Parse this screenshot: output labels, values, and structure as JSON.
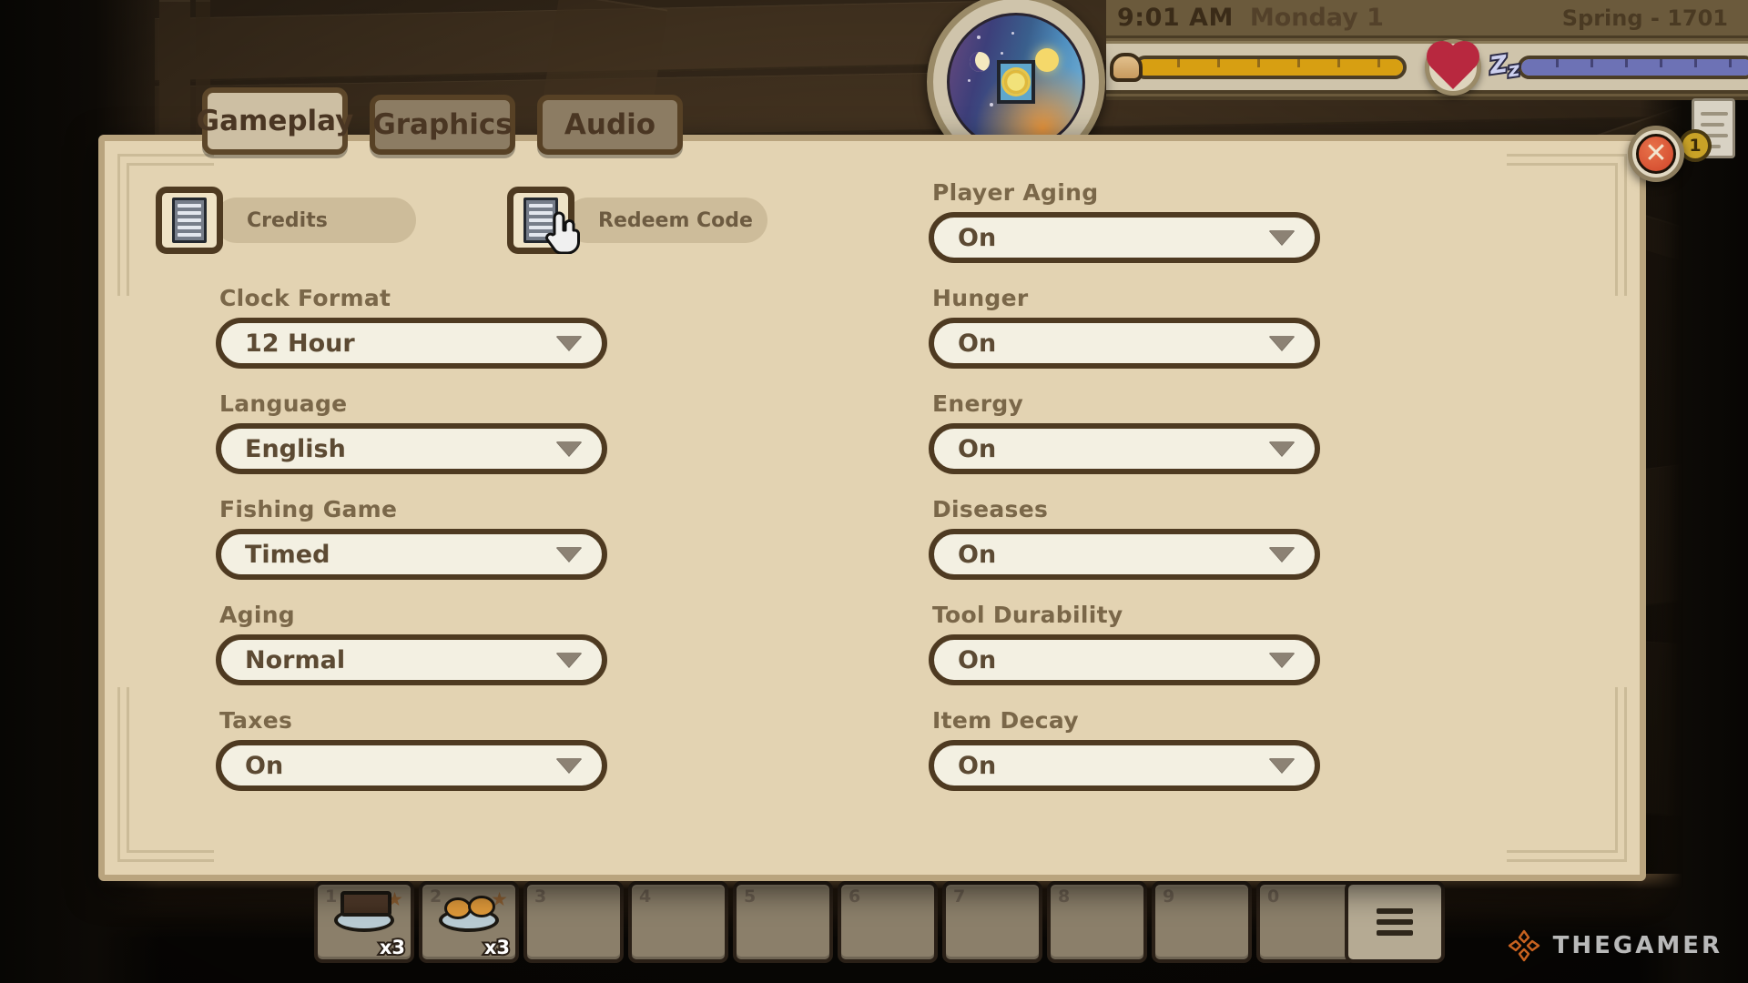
{
  "hud": {
    "time": "9:01 AM",
    "day": "Monday 1",
    "season": "Spring - 1701",
    "daynight_icon": "sun-dial-icon",
    "moon_icon": "moon-icon",
    "sun_icon": "sun-icon",
    "hunger_icon": "bread-icon",
    "hunger_percent": 100,
    "health_icon": "heart-icon",
    "energy_icon": "zzz-sleep-icon",
    "energy_percent": 100,
    "quest_icon": "scroll-icon",
    "quest_count": "1",
    "colors": {
      "hunger_fill": "#d79f12",
      "energy_fill": "#6d72b5",
      "heart": "#b8283f"
    }
  },
  "tabs": [
    {
      "label": "Gameplay",
      "active": true
    },
    {
      "label": "Graphics",
      "active": false
    },
    {
      "label": "Audio",
      "active": false
    }
  ],
  "panel": {
    "close_icon": "close-icon",
    "close_label": "✕",
    "actions": [
      {
        "label": "Credits",
        "icon": "document-icon",
        "hovered": false
      },
      {
        "label": "Redeem Code",
        "icon": "document-icon",
        "hovered": true
      }
    ],
    "left_column": [
      {
        "label": "Clock Format",
        "value": "12 Hour"
      },
      {
        "label": "Language",
        "value": "English"
      },
      {
        "label": "Fishing Game",
        "value": "Timed"
      },
      {
        "label": "Aging",
        "value": "Normal"
      },
      {
        "label": "Taxes",
        "value": "On"
      }
    ],
    "right_column": [
      {
        "label": "Player Aging",
        "value": "On"
      },
      {
        "label": "Hunger",
        "value": "On"
      },
      {
        "label": "Energy",
        "value": "On"
      },
      {
        "label": "Diseases",
        "value": "On"
      },
      {
        "label": "Tool Durability",
        "value": "On"
      },
      {
        "label": "Item Decay",
        "value": "On"
      }
    ],
    "caret_icon": "chevron-down-icon"
  },
  "hotbar": {
    "slots": [
      {
        "num": "1",
        "item": "bread-loaf-on-plate",
        "count": "x3",
        "starred": true
      },
      {
        "num": "2",
        "item": "eggs-on-plate",
        "count": "x3",
        "starred": true
      },
      {
        "num": "3",
        "item": "",
        "count": "",
        "starred": false
      },
      {
        "num": "4",
        "item": "",
        "count": "",
        "starred": false
      },
      {
        "num": "5",
        "item": "",
        "count": "",
        "starred": false
      },
      {
        "num": "6",
        "item": "",
        "count": "",
        "starred": false
      },
      {
        "num": "7",
        "item": "",
        "count": "",
        "starred": false
      },
      {
        "num": "8",
        "item": "",
        "count": "",
        "starred": false
      },
      {
        "num": "9",
        "item": "",
        "count": "",
        "starred": false
      },
      {
        "num": "0",
        "item": "",
        "count": "",
        "starred": false
      }
    ],
    "menu_icon": "hamburger-menu-icon"
  },
  "watermark": {
    "text": "THEGAMER",
    "logo_icon": "thegamer-logo-icon",
    "accent": "#c8621f"
  }
}
